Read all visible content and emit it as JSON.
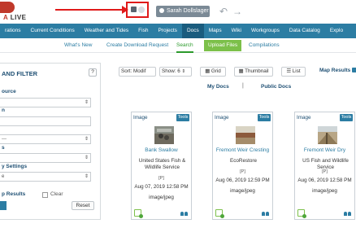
{
  "header": {
    "logo_text": "LIVE",
    "logo_prefix": "A",
    "user_name": "Sarah Dollslager",
    "colors": {
      "brand": "#c0392b",
      "nav": "#2c7da3",
      "accent_green": "#7cc04a",
      "annotation_red": "#e01a1a"
    }
  },
  "main_nav": {
    "items": [
      "rations",
      "Current Conditions",
      "Weather and Tides",
      "Fish",
      "Projects",
      "Docs",
      "Maps",
      "Wiki",
      "Workgroups",
      "Data Catalog",
      "Explo"
    ],
    "active": "Docs"
  },
  "sub_nav": {
    "whats_new": "What's New",
    "create_download": "Create Download Request",
    "search": "Search",
    "upload": "Upload Files",
    "compilations": "Compilations"
  },
  "left_panel": {
    "title": "AND FILTER",
    "help": "?",
    "labels": [
      "ource",
      "n",
      "s",
      "y Settings"
    ],
    "fields": [
      "",
      "",
      "---",
      "",
      "e"
    ],
    "results_label": "p Results",
    "clear_label": "Clear",
    "reset_label": "Reset"
  },
  "toolbar": {
    "sort_value": "Sort: Modif",
    "show_value": "Show: 6",
    "grid_label": "Grid",
    "thumbnail_label": "Thumbnail",
    "list_label": "List",
    "map_results_label": "Map Results",
    "my_docs": "My Docs",
    "separator": "|",
    "public_docs": "Public Docs"
  },
  "cards": [
    {
      "type": "Image",
      "tools": "Tools",
      "title": "Bank Swallow",
      "org": "United States Fish & Wildlife Service",
      "tag": "[P]",
      "date": "Aug 07, 2019 12:58 PM",
      "mime": "image/jpeg"
    },
    {
      "type": "Image",
      "tools": "Tools",
      "title": "Fremont Weir Cresting",
      "org": "EcoRestore",
      "tag": "[P]",
      "date": "Aug 06, 2019 12:59 PM",
      "mime": "image/jpeg"
    },
    {
      "type": "Image",
      "tools": "Tools",
      "title": "Fremont Weir Dry",
      "org": "US Fish and Wildlife Service",
      "tag": "[P]",
      "date": "Aug 06, 2019 12:58 PM",
      "mime": "image/jpeg"
    }
  ]
}
